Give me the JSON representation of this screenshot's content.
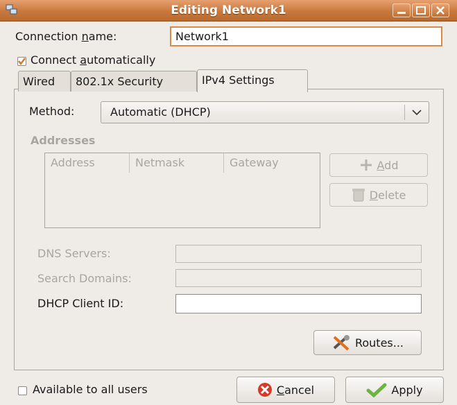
{
  "window": {
    "title": "Editing Network1",
    "accent": "#c9783c"
  },
  "connection": {
    "name_label_pre": "Connection ",
    "name_label_u": "n",
    "name_label_post": "ame:",
    "name_value": "Network1",
    "auto_label_pre": "Connect ",
    "auto_label_u": "a",
    "auto_label_post": "utomatically",
    "auto_checked": true
  },
  "tabs": [
    {
      "label": "Wired",
      "active": false
    },
    {
      "label": "802.1x Security",
      "active": false
    },
    {
      "label": "IPv4 Settings",
      "active": true
    }
  ],
  "ipv4": {
    "method_label": "Method:",
    "method_value": "Automatic (DHCP)",
    "addresses_heading": "Addresses",
    "columns": [
      "Address",
      "Netmask",
      "Gateway"
    ],
    "add_pre": "",
    "add_u": "A",
    "add_post": "dd",
    "delete_u": "D",
    "delete_post": "elete",
    "dns_label": "DNS Servers:",
    "search_label": "Search Domains:",
    "dhcp_label": "DHCP Client ID:",
    "routes_label": "Routes..."
  },
  "footer": {
    "available_label": "Available to all users",
    "available_checked": false,
    "cancel_u": "C",
    "cancel_post": "ancel",
    "apply_label": "Apply"
  }
}
